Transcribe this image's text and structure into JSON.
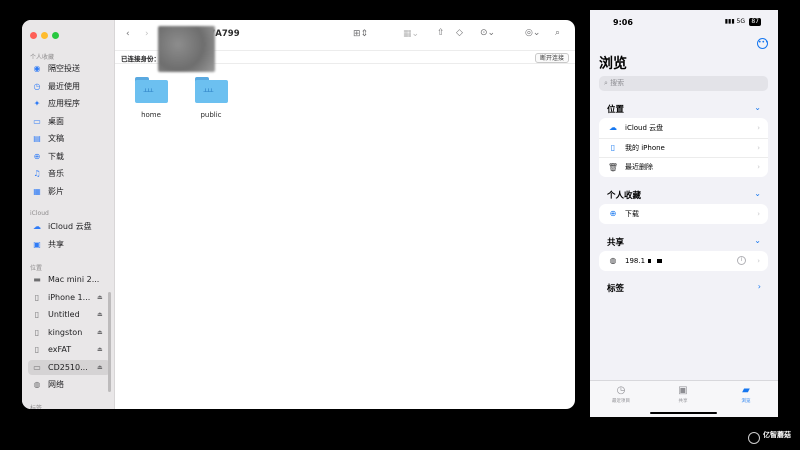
{
  "finder": {
    "title": "CD2510-47A799",
    "connected_label": "已连接身份：",
    "disconnect_label": "断开连接",
    "sidebar": {
      "favorites_header": "个人收藏",
      "favorites": [
        {
          "label": "隔空投送",
          "icon": "airdrop-icon"
        },
        {
          "label": "最近使用",
          "icon": "clock-icon"
        },
        {
          "label": "应用程序",
          "icon": "applications-icon"
        },
        {
          "label": "桌面",
          "icon": "desktop-icon"
        },
        {
          "label": "文稿",
          "icon": "document-icon"
        },
        {
          "label": "下载",
          "icon": "download-icon"
        },
        {
          "label": "音乐",
          "icon": "music-icon"
        },
        {
          "label": "影片",
          "icon": "movie-icon"
        }
      ],
      "icloud_header": "iCloud",
      "icloud": [
        {
          "label": "iCloud 云盘",
          "icon": "cloud-icon"
        },
        {
          "label": "共享",
          "icon": "shared-folder-icon"
        }
      ],
      "locations_header": "位置",
      "locations": [
        {
          "label": "Mac mini 2...",
          "icon": "mac-mini-icon"
        },
        {
          "label": "iPhone 1...",
          "icon": "iphone-icon",
          "eject": true
        },
        {
          "label": "Untitled",
          "icon": "drive-icon",
          "eject": true
        },
        {
          "label": "kingston",
          "icon": "drive-icon",
          "eject": true
        },
        {
          "label": "exFAT",
          "icon": "drive-icon",
          "eject": true
        },
        {
          "label": "CD2510...",
          "icon": "monitor-icon",
          "eject": true,
          "selected": true
        },
        {
          "label": "网络",
          "icon": "network-icon"
        }
      ],
      "tags_header": "标签"
    },
    "folders": [
      {
        "name": "home"
      },
      {
        "name": "public"
      }
    ]
  },
  "phone": {
    "time": "9:06",
    "signal": "5G",
    "battery": "87",
    "title": "浏览",
    "search_placeholder": "搜索",
    "locations_header": "位置",
    "locations": [
      {
        "label": "iCloud 云盘",
        "icon": "cloud-icon"
      },
      {
        "label": "我的 iPhone",
        "icon": "iphone-icon"
      },
      {
        "label": "最近删除",
        "icon": "trash-icon"
      }
    ],
    "favorites_header": "个人收藏",
    "favorites": [
      {
        "label": "下载",
        "icon": "download-icon"
      }
    ],
    "shared_header": "共享",
    "shared": [
      {
        "label": "198.1",
        "icon": "globe-icon"
      }
    ],
    "tags_header": "标签",
    "tabs": [
      {
        "label": "最近项目",
        "icon": "clock-icon"
      },
      {
        "label": "共享",
        "icon": "shared-folder-icon"
      },
      {
        "label": "浏览",
        "icon": "folder-icon",
        "selected": true
      }
    ]
  },
  "watermark": "亿智蘑菇"
}
